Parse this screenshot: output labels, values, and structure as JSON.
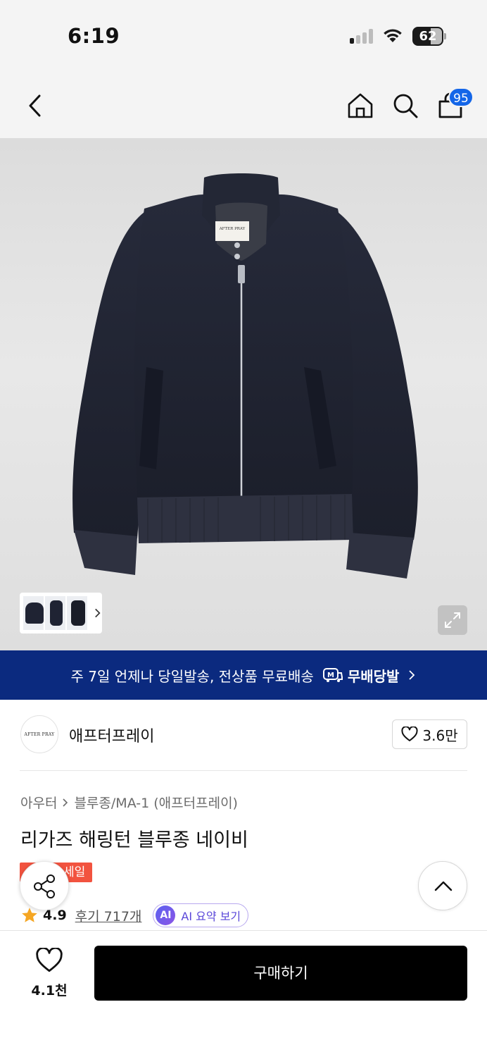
{
  "status_bar": {
    "time": "6:19",
    "battery": "62",
    "icons": [
      "signal-icon",
      "wifi-icon",
      "battery-icon"
    ]
  },
  "header": {
    "back_icon": "chevron-left-icon",
    "home_icon": "home-icon",
    "search_icon": "search-icon",
    "cart_icon": "shopping-bag-icon",
    "cart_count": "95"
  },
  "product_image": {
    "tag_text": "AFTER PRAY",
    "thumbnail_count": 3,
    "expand_icon": "expand-icon"
  },
  "delivery_banner": {
    "text": "주 7일 언제나 당일발송, 전상품 무료배송",
    "brand": "무배당발",
    "brand_icon_letter": "M"
  },
  "brand": {
    "logo_text": "AFTER PRAY",
    "name": "애프터프레이",
    "likes": "3.6만"
  },
  "breadcrumb": {
    "category": "아우터",
    "subcategory": "블루종/MA-1 (애프터프레이)"
  },
  "product": {
    "title": "리가즈 해링턴 블루종 네이비",
    "sale_label": "세일",
    "rating": "4.9",
    "reviews": "후기 717개",
    "ai_badge": "AI",
    "ai_label": "AI 요약 보기"
  },
  "bottom_bar": {
    "wish_count": "4.1천",
    "buy_label": "구매하기"
  },
  "colors": {
    "cart_badge": "#1466e8",
    "delivery_banner": "#0b2a7f",
    "sale_badge": "#f2533f",
    "star": "#f5a623",
    "buy_button": "#000000",
    "ai_accent": "#5a47d9"
  }
}
